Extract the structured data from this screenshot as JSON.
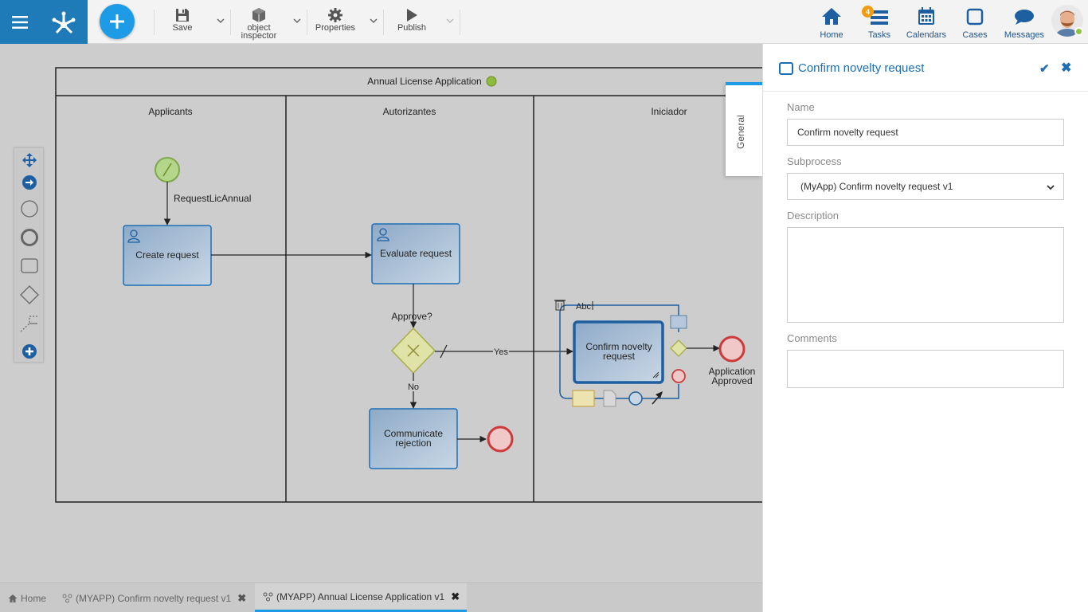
{
  "toolbar": {
    "save_label": "Save",
    "inspector_label_1": "object",
    "inspector_label_2": "inspector",
    "properties_label": "Properties",
    "publish_label": "Publish"
  },
  "nav": {
    "home": "Home",
    "tasks": "Tasks",
    "tasks_badge": "4",
    "calendars": "Calendars",
    "cases": "Cases",
    "messages": "Messages"
  },
  "diagram": {
    "pool_title": "Annual License Application",
    "lanes": [
      "Applicants",
      "Autorizantes",
      "Iniciador"
    ],
    "start_event_label": "RequestLicAnnual",
    "task_create": "Create request",
    "task_evaluate": "Evaluate request",
    "gateway_label": "Approve?",
    "flow_yes": "Yes",
    "flow_no": "No",
    "task_communicate_1": "Communicate",
    "task_communicate_2": "rejection",
    "task_confirm_1": "Confirm novelty",
    "task_confirm_2": "request",
    "end_approved_1": "Application",
    "end_approved_2": "Approved",
    "text_tool": "Abc"
  },
  "panel": {
    "side_tab": "General",
    "title": "Confirm novelty request",
    "name_label": "Name",
    "name_value": "Confirm novelty request",
    "subprocess_label": "Subprocess",
    "subprocess_value": "(MyApp) Confirm novelty request v1",
    "description_label": "Description",
    "comments_label": "Comments"
  },
  "tabs": {
    "home": "Home",
    "tab1": "(MYAPP) Confirm novelty request v1",
    "tab2": "(MYAPP) Annual License Application v1"
  },
  "colors": {
    "brand": "#1f7ab8",
    "accent": "#1e9be6",
    "task_fill": "#b8cde0",
    "task_border": "#1d6fb5",
    "gateway_fill": "#dfe3a8",
    "end_event": "#d9534f",
    "start_event": "#8dc63f"
  }
}
